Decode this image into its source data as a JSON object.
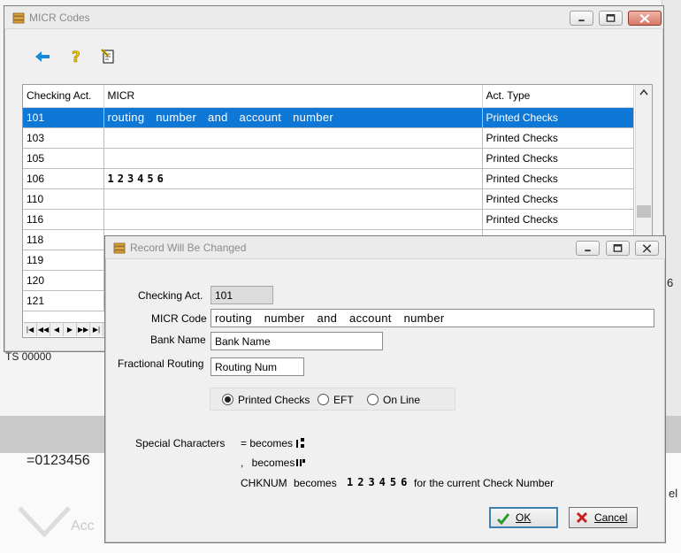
{
  "background": {
    "fragment_ts": "TS 00000",
    "fragment_numbers": "=0123456",
    "fragment_right_1": "6",
    "fragment_right_2": "el",
    "fragment_acc": "Acc"
  },
  "micr_window": {
    "title": "MICR Codes",
    "toolbar": {
      "back_icon": "back-arrow-icon",
      "help_icon": "help-question-icon",
      "edit_icon": "edit-document-icon"
    },
    "columns": [
      "Checking Act.",
      "MICR",
      "Act. Type"
    ],
    "rows": [
      {
        "account": "101",
        "micr": "routing number and account number",
        "type": "Printed Checks",
        "selected": true
      },
      {
        "account": "103",
        "micr": "",
        "type": "Printed Checks"
      },
      {
        "account": "105",
        "micr": "",
        "type": "Printed Checks"
      },
      {
        "account": "106",
        "micr": "⑆⑈⑉⑊⑂⑃",
        "type": "Printed Checks"
      },
      {
        "account": "110",
        "micr": "",
        "type": "Printed Checks"
      },
      {
        "account": "116",
        "micr": "",
        "type": "Printed Checks"
      },
      {
        "account": "118",
        "micr": "",
        "type": ""
      },
      {
        "account": "119",
        "micr": "",
        "type": ""
      },
      {
        "account": "120",
        "micr": "",
        "type": ""
      },
      {
        "account": "121",
        "micr": "",
        "type": ""
      }
    ],
    "micr_sample_display": "123456"
  },
  "record_dialog": {
    "title": "Record Will Be Changed",
    "checking_act_label": "Checking Act.",
    "checking_act_value": "101",
    "micr_code_label": "MICR Code",
    "micr_code_value": "routing number and account number",
    "bank_name_label": "Bank Name",
    "bank_name_value": "Bank Name",
    "fractional_routing_label": "Fractional Routing",
    "fractional_routing_value": "Routing Num",
    "account_type_options": [
      "Printed Checks",
      "EFT",
      "On Line"
    ],
    "account_type_selected": "Printed Checks",
    "special_characters_label": "Special Characters",
    "sc_equals": "= becomes",
    "sc_comma": ", becomes",
    "sc_chknum": "CHKNUM  becomes",
    "sc_chknum_sample": "123456",
    "sc_chknum_suffix": "for the current Check Number",
    "ok_label": "OK",
    "cancel_label": "Cancel"
  },
  "colors": {
    "selection": "#0f78d7",
    "close_button": "#d77867",
    "accent": "#3c7fb1"
  }
}
